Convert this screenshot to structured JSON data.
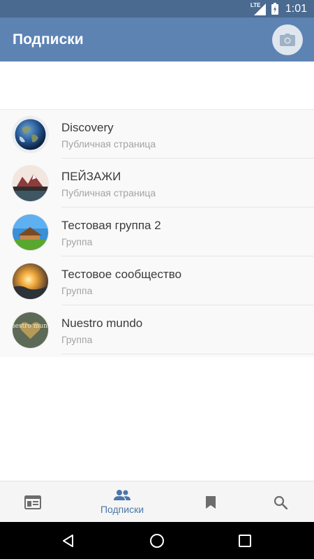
{
  "status_bar": {
    "network": "LTE",
    "time": "1:01"
  },
  "app_bar": {
    "title": "Подписки"
  },
  "subscriptions": [
    {
      "name": "Discovery",
      "type": "Публичная страница",
      "avatar": "earth-globe"
    },
    {
      "name": "ПЕЙЗАЖИ",
      "type": "Публичная страница",
      "avatar": "mountain-landscape"
    },
    {
      "name": "Тестовая группа 2",
      "type": "Группа",
      "avatar": "house-on-field"
    },
    {
      "name": "Тестовое сообщество",
      "type": "Группа",
      "avatar": "sunset"
    },
    {
      "name": "Nuestro mundo",
      "type": "Группа",
      "avatar": "heart-logo",
      "avatar_text": "Nuestro mundo"
    }
  ],
  "bottom_nav": [
    {
      "icon": "news-icon",
      "label": ""
    },
    {
      "icon": "people-icon",
      "label": "Подписки",
      "active": true
    },
    {
      "icon": "bookmark-icon",
      "label": ""
    },
    {
      "icon": "search-icon",
      "label": ""
    }
  ],
  "colors": {
    "status_bar": "#4a6a8f",
    "app_bar": "#5d83b3",
    "accent": "#4a76a8"
  }
}
